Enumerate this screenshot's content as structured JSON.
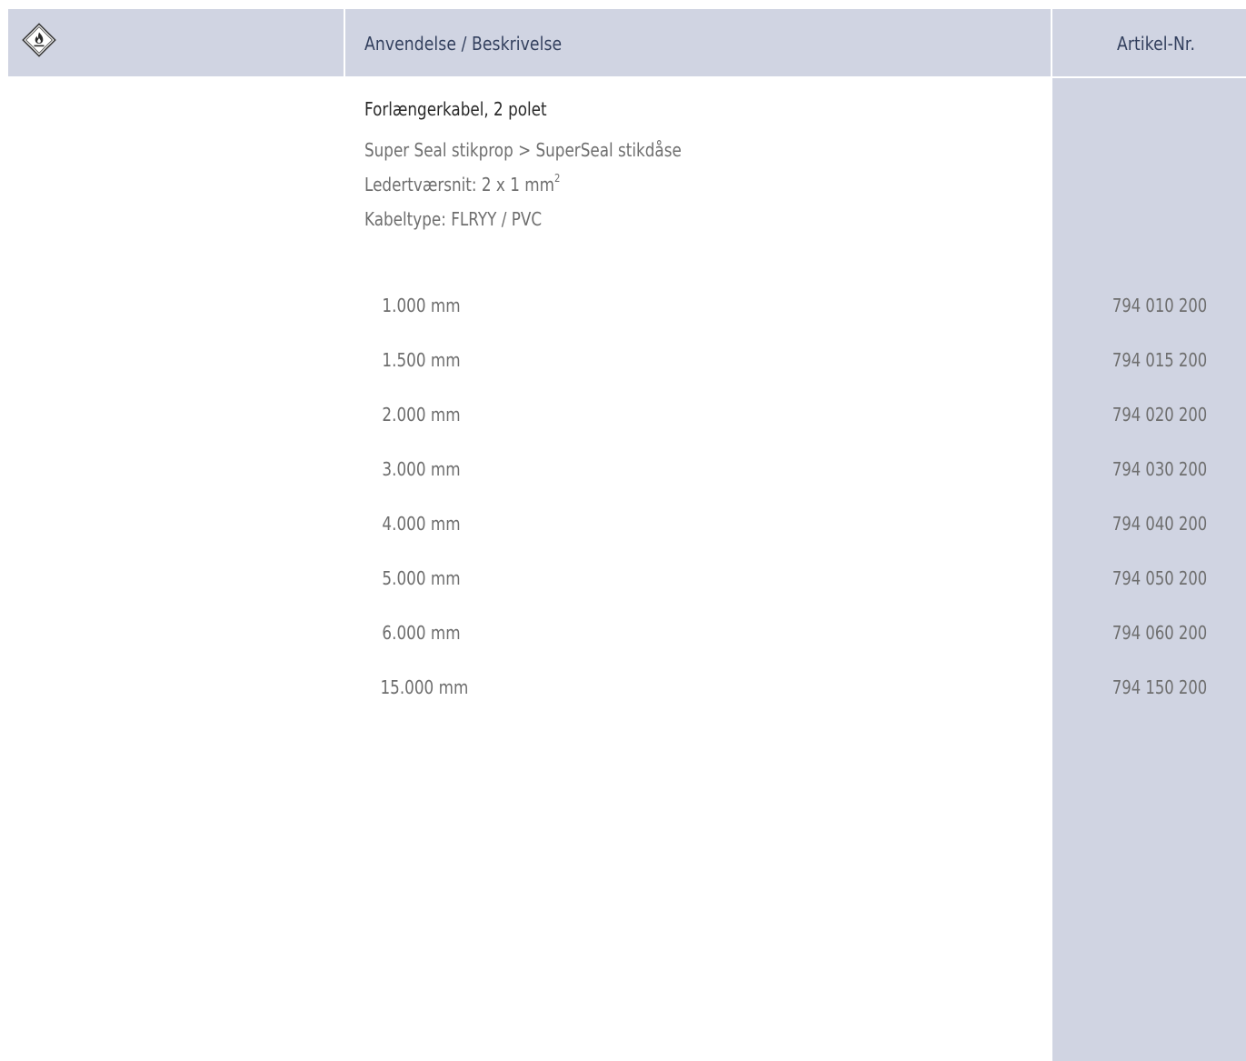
{
  "header": {
    "icon": "flammable-hazard-icon",
    "desc_label": "Anvendelse / Beskrivelse",
    "art_label": "Artikel-Nr."
  },
  "product": {
    "title": "Forlængerkabel, 2 polet",
    "line1": "Super Seal stikprop > SuperSeal stikdåse",
    "line2_prefix": "Ledertværsnit: 2 x 1 mm",
    "line2_sup": "2",
    "line3": "Kabeltype: FLRYY / PVC"
  },
  "rows": [
    {
      "length": "1.000 mm",
      "article": "794 010 200"
    },
    {
      "length": "1.500 mm",
      "article": "794 015 200"
    },
    {
      "length": "2.000 mm",
      "article": "794 020 200"
    },
    {
      "length": "3.000 mm",
      "article": "794 030 200"
    },
    {
      "length": "4.000 mm",
      "article": "794 040 200"
    },
    {
      "length": "5.000 mm",
      "article": "794 050 200"
    },
    {
      "length": "6.000 mm",
      "article": "794 060 200"
    },
    {
      "length": "15.000 mm",
      "article": "794 150 200"
    }
  ],
  "colors": {
    "band": "#d0d4e2",
    "header_text": "#33405e",
    "body_text": "#6e6e6e"
  }
}
